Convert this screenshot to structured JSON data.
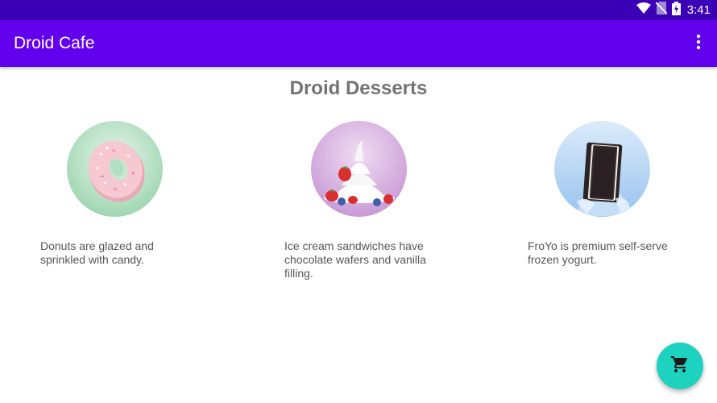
{
  "status_bar": {
    "time": "3:41",
    "icons": [
      "wifi-icon",
      "no-sim-icon",
      "battery-icon"
    ]
  },
  "app_bar": {
    "title": "Droid Cafe",
    "overflow_icon": "more-vert-icon"
  },
  "main": {
    "title": "Droid Desserts",
    "desserts": [
      {
        "image": "donut-image",
        "description": "Donuts are glazed and sprinkled with candy."
      },
      {
        "image": "froyo-image",
        "description": "Ice cream sandwiches have chocolate wafers and vanilla filling."
      },
      {
        "image": "ice-cream-sandwich-image",
        "description": "FroYo is premium self-serve frozen yogurt."
      }
    ]
  },
  "fab": {
    "icon": "shopping-cart-icon"
  },
  "colors": {
    "status_bar": "#3b00b5",
    "app_bar": "#6200ee",
    "fab": "#1ed2c0",
    "title_text": "#737373"
  }
}
